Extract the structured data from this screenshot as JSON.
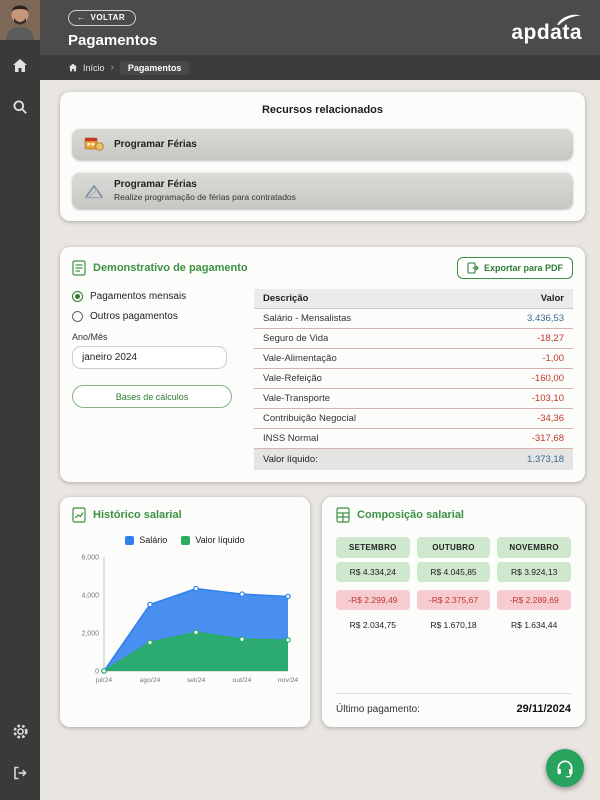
{
  "header": {
    "back_label": "VOLTAR",
    "title": "Pagamentos",
    "breadcrumb": {
      "home": "Início",
      "current": "Pagamentos"
    },
    "logo": "apdata"
  },
  "related": {
    "title": "Recursos relacionados",
    "items": [
      {
        "label": "Programar Férias",
        "subtitle": ""
      },
      {
        "label": "Programar Férias",
        "subtitle": "Realize programação de férias para contratados"
      }
    ]
  },
  "statement": {
    "title": "Demonstrativo de pagamento",
    "export_label": "Exportar para PDF",
    "radio_monthly": "Pagamentos mensais",
    "radio_other": "Outros pagamentos",
    "period_label": "Ano/Mês",
    "period_value": "janeiro 2024",
    "bases_label": "Bases de cálculos",
    "table": {
      "col_desc": "Descrição",
      "col_value": "Valor",
      "rows": [
        {
          "desc": "Salário - Mensalistas",
          "value": "3.436,53",
          "type": "positive"
        },
        {
          "desc": "Seguro de Vida",
          "value": "-18,27",
          "type": "negative"
        },
        {
          "desc": "Vale-Alimentação",
          "value": "-1,00",
          "type": "negative"
        },
        {
          "desc": "Vale-Refeição",
          "value": "-160,00",
          "type": "negative"
        },
        {
          "desc": "Vale-Transporte",
          "value": "-103,10",
          "type": "negative"
        },
        {
          "desc": "Contribuição Negocial",
          "value": "-34,36",
          "type": "negative"
        },
        {
          "desc": "INSS Normal",
          "value": "-317,68",
          "type": "negative"
        }
      ],
      "footer_label": "Valor líquido:",
      "footer_value": "1.373,18"
    }
  },
  "history": {
    "title": "Histórico salarial"
  },
  "chart_data": {
    "type": "area",
    "title": "Histórico salarial",
    "x": [
      "jul/24",
      "ago/24",
      "set/24",
      "out/24",
      "nov/24"
    ],
    "series": [
      {
        "name": "Salário",
        "color": "#2f80ed",
        "values": [
          0,
          3500,
          4334,
          4046,
          3924
        ]
      },
      {
        "name": "Valor líquido",
        "color": "#27ae60",
        "values": [
          0,
          1500,
          2035,
          1670,
          1634
        ]
      }
    ],
    "ylim": [
      0,
      6000
    ],
    "yticks": [
      {
        "value": 0,
        "label": "0"
      },
      {
        "value": 2000,
        "label": "2,000"
      },
      {
        "value": 4000,
        "label": "4,000"
      },
      {
        "value": 6000,
        "label": "6,000"
      }
    ],
    "legend_position": "top",
    "grid": false
  },
  "composition": {
    "title": "Composição salarial",
    "months": [
      {
        "name": "SETEMBRO",
        "gross": "R$ 4.334,24",
        "deductions": "-R$ 2.299,49",
        "net": "R$ 2.034,75"
      },
      {
        "name": "OUTUBRO",
        "gross": "R$ 4.045,85",
        "deductions": "-R$ 2.375,67",
        "net": "R$ 1.670,18"
      },
      {
        "name": "NOVEMBRO",
        "gross": "R$ 3.924,13",
        "deductions": "-R$ 2.289,69",
        "net": "R$ 1.634,44"
      }
    ],
    "last_payment_label": "Último pagamento:",
    "last_payment_value": "29/11/2024"
  },
  "icons": {
    "sidebar": [
      "home-icon",
      "search-icon",
      "settings-gear-icon",
      "logout-icon"
    ],
    "fab": "headset-icon"
  },
  "colors": {
    "accent_green": "#3c9142",
    "negative_red": "#c0392b",
    "value_blue": "#3a6b9d",
    "chart_blue": "#2f80ed",
    "chart_green": "#27ae60"
  }
}
